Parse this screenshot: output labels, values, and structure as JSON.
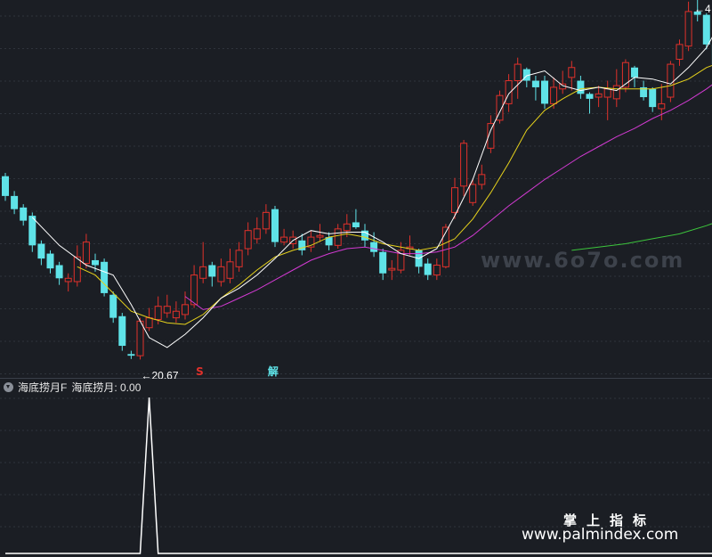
{
  "main_chart": {
    "low_marker": "←20.67",
    "high_marker": "←4",
    "signals": [
      {
        "label": "S",
        "color": "#e0312b",
        "x_index": 21
      },
      {
        "label": "解",
        "color": "#5fe3e8",
        "x_index": 29
      }
    ]
  },
  "sub_panel": {
    "indicator_name": "海底捞月F",
    "readout": "海底捞月: 0.00"
  },
  "watermarks": {
    "line1": "www.6o7o.com",
    "line2": "掌上指标",
    "line3": "www.palmindex.com"
  },
  "colors": {
    "up": "#e0312b",
    "down": "#5fe3e8",
    "ma_white": "#ffffff",
    "ma_yellow": "#e6d21c",
    "ma_magenta": "#d23ad2",
    "ma_green": "#3cc43c",
    "grid": "#2f343c"
  },
  "chart_data": [
    {
      "type": "candlestick",
      "title": "",
      "ylim": [
        19.5,
        42.5
      ],
      "low_label_value": 20.67,
      "candles": [
        [
          31.8,
          30.6,
          32.0,
          30.3
        ],
        [
          30.6,
          29.8,
          30.9,
          29.5
        ],
        [
          29.9,
          29.1,
          30.1,
          28.8
        ],
        [
          29.4,
          27.6,
          29.6,
          27.2
        ],
        [
          27.7,
          26.8,
          27.9,
          26.4
        ],
        [
          27.1,
          26.2,
          27.3,
          25.9
        ],
        [
          26.4,
          25.6,
          26.6,
          25.2
        ],
        [
          25.4,
          25.6,
          25.9,
          24.8
        ],
        [
          25.4,
          26.9,
          27.6,
          25.1
        ],
        [
          26.5,
          27.8,
          28.3,
          26.2
        ],
        [
          26.7,
          26.4,
          27.1,
          26.0
        ],
        [
          26.6,
          24.7,
          26.8,
          24.5
        ],
        [
          24.6,
          23.2,
          24.8,
          22.9
        ],
        [
          23.3,
          21.5,
          23.5,
          21.2
        ],
        [
          21.0,
          20.9,
          21.2,
          20.7
        ],
        [
          20.9,
          23.0,
          23.2,
          20.67
        ],
        [
          22.6,
          23.2,
          23.8,
          22.4
        ],
        [
          23.1,
          23.9,
          24.5,
          22.8
        ],
        [
          23.5,
          23.9,
          24.6,
          23.2
        ],
        [
          23.2,
          23.6,
          24.2,
          22.9
        ],
        [
          23.4,
          24.0,
          24.8,
          23.1
        ],
        [
          24.0,
          25.8,
          26.4,
          23.8
        ],
        [
          25.6,
          26.3,
          27.8,
          25.3
        ],
        [
          26.4,
          25.7,
          26.6,
          25.1
        ],
        [
          25.4,
          26.3,
          26.8,
          25.1
        ],
        [
          25.6,
          26.6,
          27.4,
          25.3
        ],
        [
          26.3,
          27.3,
          27.8,
          26.0
        ],
        [
          27.4,
          28.5,
          29.0,
          27.0
        ],
        [
          28.0,
          28.6,
          29.3,
          27.7
        ],
        [
          28.6,
          29.6,
          30.1,
          28.3
        ],
        [
          29.8,
          27.8,
          30.0,
          27.5
        ],
        [
          27.8,
          28.1,
          28.6,
          27.6
        ],
        [
          27.7,
          28.1,
          28.5,
          27.4
        ],
        [
          27.9,
          27.3,
          28.3,
          27.0
        ],
        [
          27.5,
          28.1,
          28.5,
          27.2
        ],
        [
          28.1,
          28.2,
          28.9,
          27.8
        ],
        [
          28.1,
          27.6,
          28.4,
          27.3
        ],
        [
          27.6,
          28.6,
          28.9,
          27.4
        ],
        [
          28.5,
          28.9,
          29.5,
          28.1
        ],
        [
          29.0,
          28.7,
          29.8,
          28.6
        ],
        [
          28.5,
          27.9,
          28.9,
          27.5
        ],
        [
          27.8,
          27.2,
          28.4,
          26.9
        ],
        [
          27.2,
          25.9,
          27.4,
          25.5
        ],
        [
          26.1,
          26.2,
          26.7,
          25.5
        ],
        [
          26.1,
          27.3,
          27.8,
          25.9
        ],
        [
          27.4,
          27.5,
          28.2,
          27.0
        ],
        [
          27.3,
          26.3,
          27.4,
          25.9
        ],
        [
          26.5,
          25.8,
          26.8,
          25.5
        ],
        [
          25.8,
          26.4,
          26.8,
          25.5
        ],
        [
          26.3,
          28.7,
          28.9,
          26.2
        ],
        [
          29.6,
          31.1,
          31.7,
          29.2
        ],
        [
          31.2,
          33.8,
          34.0,
          30.6
        ],
        [
          30.2,
          31.3,
          31.6,
          30.0
        ],
        [
          31.3,
          31.9,
          32.5,
          31.0
        ],
        [
          33.5,
          35.0,
          35.5,
          33.2
        ],
        [
          35.2,
          36.7,
          37.0,
          35.0
        ],
        [
          36.2,
          37.6,
          38.0,
          35.7
        ],
        [
          37.6,
          38.6,
          39.0,
          36.5
        ],
        [
          38.3,
          37.6,
          38.4,
          37.2
        ],
        [
          37.6,
          37.2,
          37.9,
          36.4
        ],
        [
          37.6,
          36.2,
          37.9,
          35.9
        ],
        [
          36.2,
          37.2,
          37.8,
          35.9
        ],
        [
          37.1,
          37.4,
          38.2,
          36.8
        ],
        [
          37.8,
          38.4,
          38.8,
          37.0
        ],
        [
          37.6,
          36.8,
          37.9,
          36.5
        ],
        [
          36.8,
          36.5,
          36.9,
          35.6
        ],
        [
          36.6,
          36.8,
          37.3,
          36.0
        ],
        [
          36.6,
          37.1,
          37.6,
          35.2
        ],
        [
          36.5,
          37.3,
          38.3,
          36.0
        ],
        [
          37.2,
          38.7,
          38.9,
          36.9
        ],
        [
          38.4,
          37.8,
          38.5,
          37.2
        ],
        [
          37.2,
          36.6,
          37.6,
          36.4
        ],
        [
          37.1,
          36.0,
          37.2,
          35.7
        ],
        [
          35.9,
          36.2,
          37.4,
          35.2
        ],
        [
          36.6,
          38.6,
          38.8,
          36.3
        ],
        [
          38.9,
          39.8,
          40.1,
          38.5
        ],
        [
          39.7,
          41.8,
          42.4,
          39.4
        ],
        [
          41.8,
          41.6,
          42.5,
          41.2
        ],
        [
          41.6,
          39.8,
          41.7,
          39.5
        ],
        [
          39.8,
          38.6,
          40.0,
          38.3
        ]
      ],
      "ma_short": [
        [
          3,
          29.3
        ],
        [
          6,
          27.6
        ],
        [
          9,
          26.4
        ],
        [
          12,
          25.8
        ],
        [
          14,
          24.0
        ],
        [
          16,
          22.0
        ],
        [
          18,
          21.4
        ],
        [
          20,
          22.2
        ],
        [
          22,
          23.2
        ],
        [
          24,
          24.4
        ],
        [
          26,
          25.0
        ],
        [
          28,
          25.8
        ],
        [
          30,
          26.8
        ],
        [
          32,
          27.9
        ],
        [
          34,
          28.5
        ],
        [
          36,
          28.3
        ],
        [
          38,
          28.4
        ],
        [
          40,
          28.4
        ],
        [
          42,
          27.8
        ],
        [
          44,
          27.1
        ],
        [
          46,
          26.8
        ],
        [
          48,
          27.4
        ],
        [
          50,
          29.4
        ],
        [
          52,
          31.6
        ],
        [
          54,
          34.6
        ],
        [
          56,
          36.8
        ],
        [
          58,
          37.9
        ],
        [
          60,
          38.2
        ],
        [
          62,
          37.3
        ],
        [
          64,
          37.0
        ],
        [
          66,
          37.2
        ],
        [
          68,
          37.0
        ],
        [
          70,
          37.8
        ],
        [
          72,
          37.7
        ],
        [
          74,
          37.4
        ],
        [
          76,
          38.4
        ],
        [
          78,
          39.6
        ],
        [
          79,
          40.6
        ]
      ],
      "ma_mid": [
        [
          8,
          26.3
        ],
        [
          10,
          25.8
        ],
        [
          12,
          24.7
        ],
        [
          14,
          23.6
        ],
        [
          16,
          23.2
        ],
        [
          18,
          22.9
        ],
        [
          20,
          22.8
        ],
        [
          22,
          23.4
        ],
        [
          24,
          24.4
        ],
        [
          26,
          25.2
        ],
        [
          28,
          26.1
        ],
        [
          30,
          26.9
        ],
        [
          32,
          27.3
        ],
        [
          34,
          27.6
        ],
        [
          36,
          28.1
        ],
        [
          38,
          28.3
        ],
        [
          40,
          28.1
        ],
        [
          42,
          27.7
        ],
        [
          44,
          27.5
        ],
        [
          46,
          27.3
        ],
        [
          48,
          27.5
        ],
        [
          50,
          28.0
        ],
        [
          52,
          29.2
        ],
        [
          54,
          30.8
        ],
        [
          56,
          32.6
        ],
        [
          58,
          34.6
        ],
        [
          60,
          35.8
        ],
        [
          62,
          36.5
        ],
        [
          64,
          37.1
        ],
        [
          66,
          37.2
        ],
        [
          68,
          37.1
        ],
        [
          70,
          37.1
        ],
        [
          72,
          37.1
        ],
        [
          74,
          37.3
        ],
        [
          76,
          37.7
        ],
        [
          78,
          38.4
        ],
        [
          79,
          38.6
        ]
      ],
      "ma_long": [
        [
          20,
          24.5
        ],
        [
          22,
          23.7
        ],
        [
          24,
          23.9
        ],
        [
          26,
          24.4
        ],
        [
          28,
          24.9
        ],
        [
          30,
          25.5
        ],
        [
          32,
          26.1
        ],
        [
          34,
          26.7
        ],
        [
          36,
          27.1
        ],
        [
          38,
          27.4
        ],
        [
          40,
          27.5
        ],
        [
          42,
          27.3
        ],
        [
          44,
          27.1
        ],
        [
          46,
          27.1
        ],
        [
          48,
          27.2
        ],
        [
          50,
          27.5
        ],
        [
          52,
          28.2
        ],
        [
          54,
          29.1
        ],
        [
          56,
          30.0
        ],
        [
          58,
          30.8
        ],
        [
          60,
          31.6
        ],
        [
          62,
          32.3
        ],
        [
          64,
          33.0
        ],
        [
          66,
          33.6
        ],
        [
          68,
          34.2
        ],
        [
          70,
          34.7
        ],
        [
          72,
          35.3
        ],
        [
          74,
          35.8
        ],
        [
          76,
          36.4
        ],
        [
          78,
          37.1
        ],
        [
          79,
          37.5
        ]
      ],
      "ma_very_long": [
        [
          63,
          27.3
        ],
        [
          66,
          27.5
        ],
        [
          69,
          27.7
        ],
        [
          72,
          28.0
        ],
        [
          75,
          28.3
        ],
        [
          78,
          28.8
        ],
        [
          79,
          29.0
        ]
      ]
    },
    {
      "type": "line",
      "title": "",
      "ylim": [
        0,
        1
      ],
      "x": [
        0,
        15,
        16,
        17,
        79
      ],
      "values": [
        0,
        0,
        1,
        0,
        0
      ]
    }
  ]
}
